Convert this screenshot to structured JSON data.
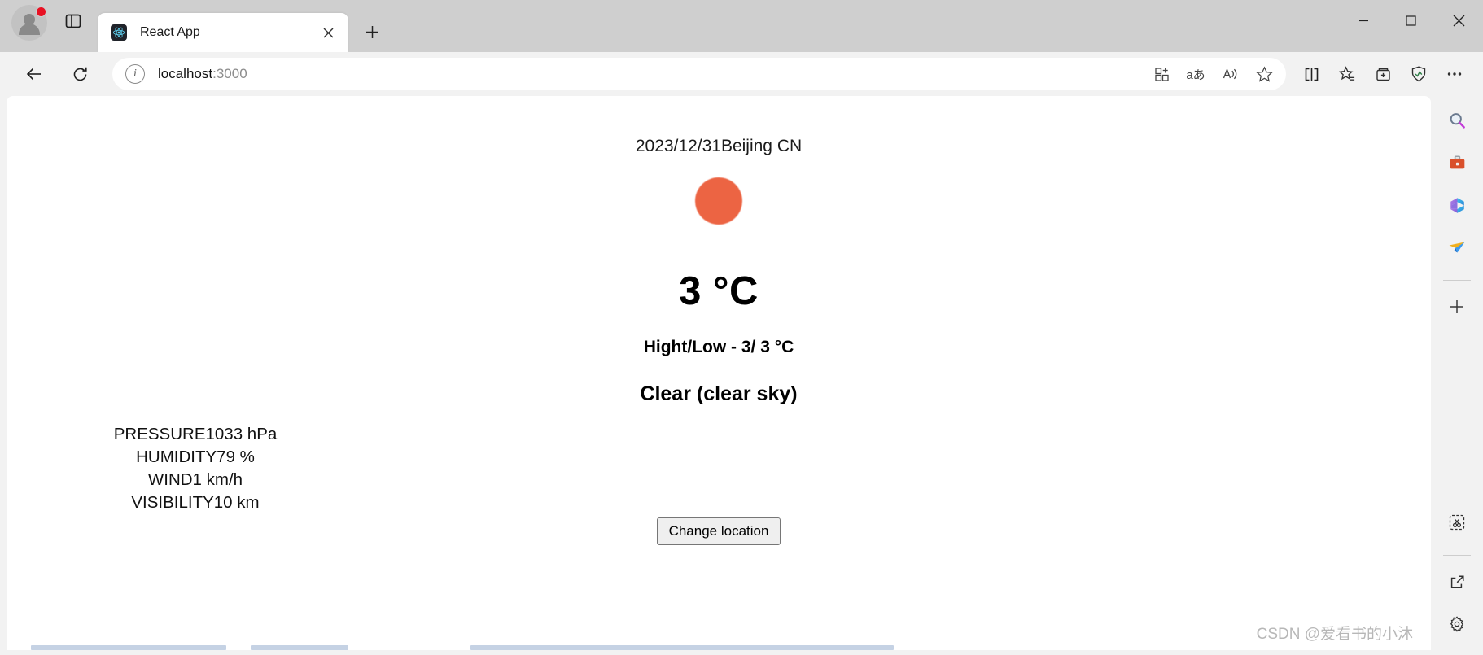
{
  "window": {
    "minimize_label": "Minimize",
    "maximize_label": "Maximize",
    "close_label": "Close"
  },
  "tabbar": {
    "profile_name": "profile-avatar",
    "tab_overview_label": "Tab actions",
    "tab": {
      "title": "React App",
      "favicon": "react-logo",
      "close_label": "Close tab"
    },
    "new_tab_label": "New tab"
  },
  "navbar": {
    "back_label": "Back",
    "reload_label": "Refresh",
    "site_info_label": "View site information",
    "url_main": "localhost",
    "url_port": ":3000",
    "actions": [
      {
        "name": "split-screen-add-icon",
        "label": "Add to collections"
      },
      {
        "name": "translate-icon",
        "label": "Translate this page"
      },
      {
        "name": "read-aloud-icon",
        "label": "Read this page aloud"
      },
      {
        "name": "favorite-star-icon",
        "label": "Add this page to favorites"
      }
    ],
    "tools": [
      {
        "name": "split-screen-icon",
        "label": "Split screen"
      },
      {
        "name": "favorites-icon",
        "label": "Favorites"
      },
      {
        "name": "collections-icon",
        "label": "Collections"
      },
      {
        "name": "browser-essentials-icon",
        "label": "Browser essentials"
      },
      {
        "name": "settings-and-more-icon",
        "label": "Settings and more"
      }
    ]
  },
  "sidebar": {
    "items": [
      {
        "name": "search-icon",
        "label": "Search",
        "glyph": "🔍"
      },
      {
        "name": "tools-briefcase-icon",
        "label": "Tools",
        "glyph": "🧰"
      },
      {
        "name": "microsoft-365-icon",
        "label": "Microsoft 365",
        "glyph": ""
      },
      {
        "name": "outlook-send-icon",
        "label": "Outlook",
        "glyph": ""
      }
    ],
    "add_label": "+",
    "bottom_items": [
      {
        "name": "screenshot-icon",
        "label": "Screenshot"
      },
      {
        "name": "open-external-icon",
        "label": "Open in new window"
      },
      {
        "name": "gear-settings-icon",
        "label": "Settings"
      }
    ]
  },
  "weather": {
    "date": "2023/12/31",
    "location": "Beijing CN",
    "date_location": "2023/12/31Beijing CN",
    "icon_name": "clear-sky-sun-icon",
    "icon_color": "#ec6443",
    "temperature": "3 °C",
    "high_low": "Hight/Low - 3/ 3 °C",
    "condition": "Clear (clear sky)",
    "details": [
      {
        "label": "PRESSURE",
        "value": "1033 hPa",
        "text": "PRESSURE1033 hPa"
      },
      {
        "label": "HUMIDITY",
        "value": "79 %",
        "text": "HUMIDITY79 %"
      },
      {
        "label": "WIND",
        "value": "1 km/h",
        "text": "WIND1 km/h"
      },
      {
        "label": "VISIBILITY",
        "value": "10 km",
        "text": "VISIBILITY10 km"
      }
    ],
    "change_location_button": "Change location"
  },
  "watermark": "CSDN @爱看书的小沐"
}
